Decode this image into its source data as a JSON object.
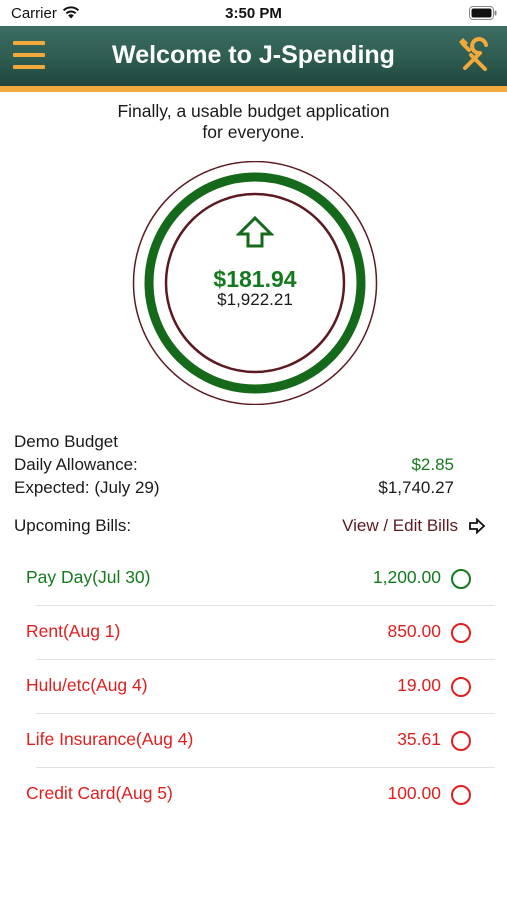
{
  "status": {
    "carrier": "Carrier",
    "time": "3:50 PM"
  },
  "nav": {
    "title": "Welcome to J-Spending"
  },
  "tagline": {
    "line1": "Finally, a usable budget application",
    "line2": "for everyone."
  },
  "balance": {
    "primary": "$181.94",
    "secondary": "$1,922.21",
    "trend_icon": "up-arrow-icon"
  },
  "summary": {
    "budget_name": "Demo Budget",
    "daily_allowance_label": "Daily Allowance:",
    "daily_allowance_value": "$2.85",
    "expected_label": "Expected: (July 29)",
    "expected_value": "$1,740.27"
  },
  "bills": {
    "header": "Upcoming Bills:",
    "view_edit": "View / Edit Bills",
    "items": [
      {
        "name": "Pay Day(Jul 30)",
        "amount": "1,200.00",
        "color": "#157a1e"
      },
      {
        "name": "Rent(Aug 1)",
        "amount": "850.00",
        "color": "#e0201f"
      },
      {
        "name": "Hulu/etc(Aug 4)",
        "amount": "19.00",
        "color": "#e0201f"
      },
      {
        "name": "Life Insurance(Aug 4)",
        "amount": "35.61",
        "color": "#e0201f"
      },
      {
        "name": "Credit Card(Aug 5)",
        "amount": "100.00",
        "color": "#e0201f"
      }
    ]
  },
  "colors": {
    "nav": "#2e5c51",
    "accent": "#f2a93b",
    "positive": "#157a1e",
    "negative": "#e0201f",
    "ring_outer": "#5b1a21"
  }
}
